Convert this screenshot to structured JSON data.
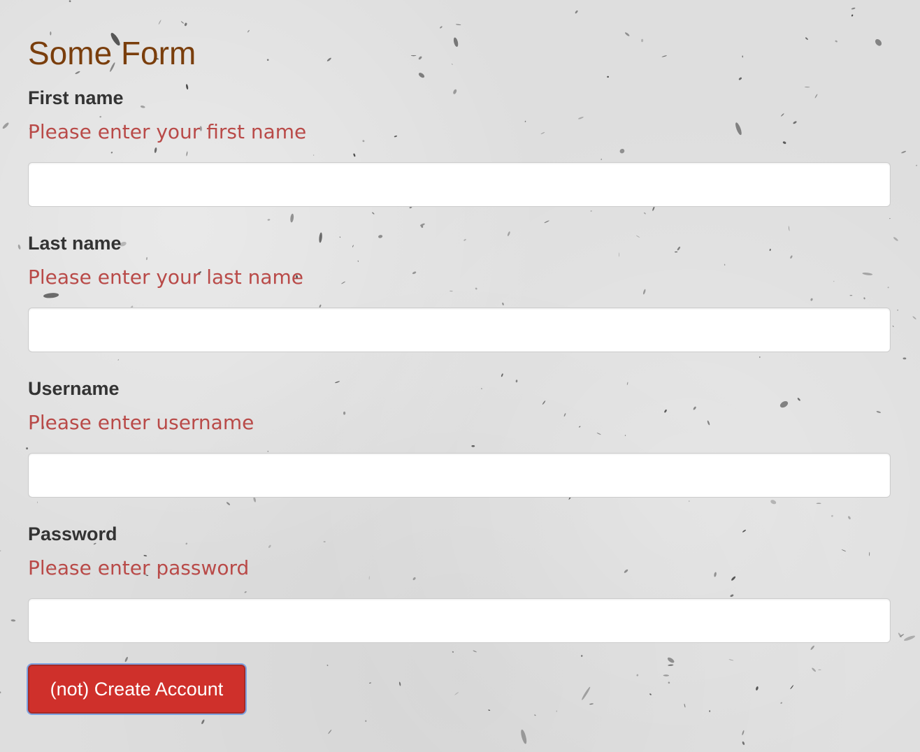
{
  "form": {
    "title": "Some Form",
    "fields": [
      {
        "label": "First name",
        "error": "Please enter your first name",
        "value": ""
      },
      {
        "label": "Last name",
        "error": "Please enter your last name",
        "value": ""
      },
      {
        "label": "Username",
        "error": "Please enter username",
        "value": ""
      },
      {
        "label": "Password",
        "error": "Please enter password",
        "value": ""
      }
    ],
    "submit_label": "(not) Create Account"
  },
  "colors": {
    "title": "#7a3e0c",
    "label": "#333333",
    "error": "#b94a48",
    "button": "#cf302b",
    "background": "#dedede"
  }
}
